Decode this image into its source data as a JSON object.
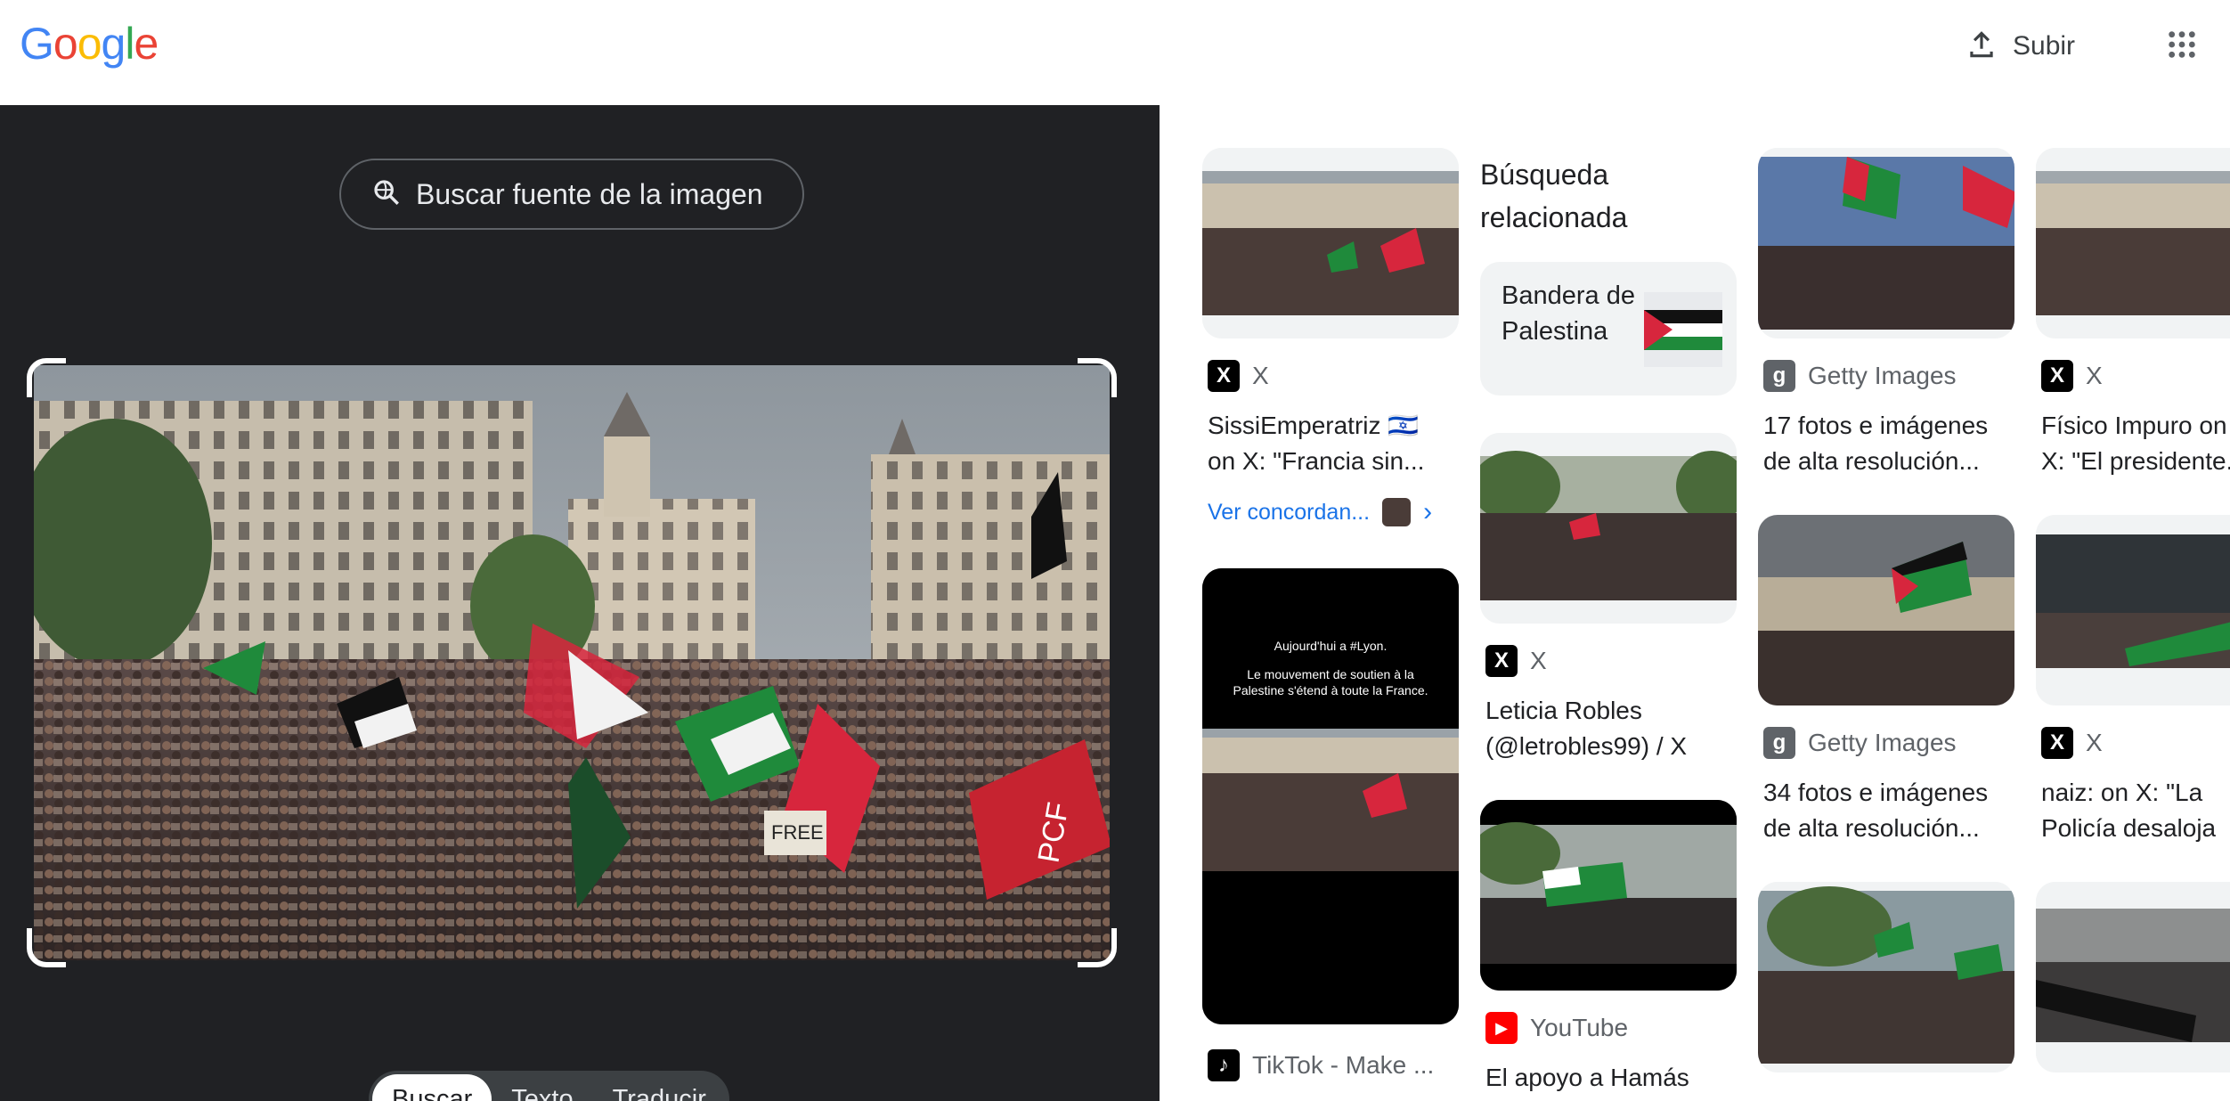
{
  "header": {
    "logo_letters": [
      "G",
      "o",
      "o",
      "g",
      "l",
      "e"
    ],
    "logo_colors": [
      "#4285F4",
      "#EA4335",
      "#FBBC05",
      "#4285F4",
      "#34A853",
      "#EA4335"
    ],
    "upload_label": "Subir",
    "upload_icon": "upload-icon",
    "apps_icon": "apps-grid-icon"
  },
  "left": {
    "source_button_label": "Buscar fuente de la imagen",
    "source_button_icon": "lens-search-icon",
    "tabs": [
      {
        "label": "Buscar",
        "active": true
      },
      {
        "label": "Texto",
        "active": false
      },
      {
        "label": "Traducir",
        "active": false
      }
    ]
  },
  "results": {
    "related_heading": "Búsqueda relacionada",
    "related_chip": {
      "label": "Bandera de Palestina"
    },
    "cards": [
      {
        "source": "X",
        "title": "SissiEmperatriz 🇮🇱 on X: \"Francia sin...",
        "match_label": "Ver concordan..."
      },
      {
        "source": "TikTok - Make ...",
        "title": ""
      },
      {
        "source": "X",
        "title": "Leticia Robles (@letrobles99) / X"
      },
      {
        "source": "YouTube",
        "title": "El apoyo a Hamás"
      },
      {
        "source": "Getty Images",
        "title": "17 fotos e imágenes de alta resolución..."
      },
      {
        "source": "Getty Images",
        "title": "34 fotos e imágenes de alta resolución..."
      },
      {
        "source": "X",
        "title": "Físico Impuro on X: \"El presidente..."
      },
      {
        "source": "X",
        "title": "naiz: on X: \"La Policía desaloja"
      }
    ],
    "tiktok_overlay": {
      "line1": "Aujourd'hui a #Lyon.",
      "line2": "Le mouvement de soutien à la Palestine s'étend à toute la France."
    },
    "photo_sign_text": "FREE",
    "photo_banner_text": "PCF"
  },
  "colors": {
    "dark_panel": "#202124",
    "link_blue": "#1a73e8",
    "flag_red": "#d7263d",
    "flag_green": "#1f8a3b",
    "flag_black": "#111111"
  }
}
